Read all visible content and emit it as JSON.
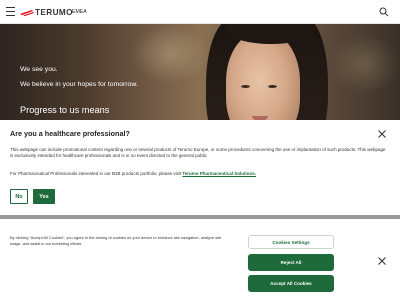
{
  "header": {
    "brand": "TERUMO",
    "region": "EMEA",
    "menu_icon": "hamburger-menu-icon",
    "search_icon": "search-icon",
    "brand_color": "#e60012"
  },
  "hero": {
    "line1": "We see you.",
    "line2": "We believe in your hopes for tomorrow.",
    "line3": "Progress to us means"
  },
  "hcp_modal": {
    "title": "Are you a healthcare professional?",
    "paragraph1": "This webpage can include promotional content regarding one or several products of Terumo Europe, or some procedures concerning the use or implantation of such products. This webpage is exclusively intended for healthcare professionals and is in no event directed to the general public",
    "paragraph2_prefix": "For Pharmaceutical Professionals interested in our B2B products portfolio, please visit ",
    "paragraph2_link": "Terumo Pharmaceutical Solutions.",
    "no_label": "No",
    "yes_label": "Yes",
    "close_icon": "close-icon",
    "accent_color": "#1f6a3b"
  },
  "cookie_banner": {
    "text": "By clicking “Accept All Cookies”, you agree to the storing of cookies on your device to enhance site navigation, analyze site usage, and assist in our marketing efforts.",
    "settings_label": "Cookies Settings",
    "reject_label": "Reject All",
    "accept_label": "Accept All Cookies",
    "close_icon": "close-icon"
  }
}
